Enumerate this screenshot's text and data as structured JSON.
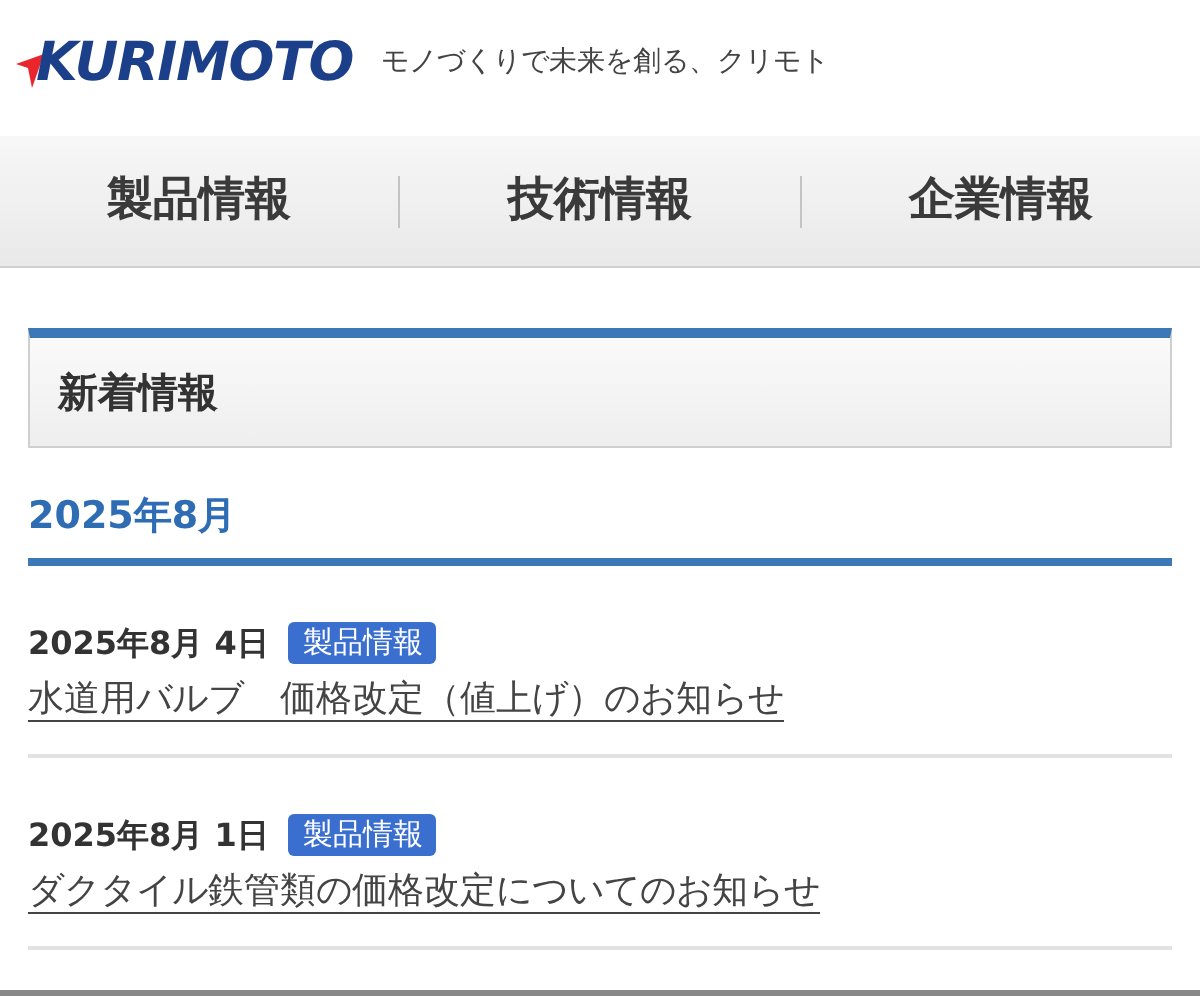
{
  "header": {
    "logo": "KURIMOTO",
    "tagline": "モノづくりで未来を創る、クリモト"
  },
  "nav": {
    "items": [
      {
        "label": "製品情報"
      },
      {
        "label": "技術情報"
      },
      {
        "label": "企業情報"
      }
    ]
  },
  "section": {
    "title": "新着情報"
  },
  "month": "2025年8月",
  "news": [
    {
      "date": "2025年8月 4日",
      "tag": "製品情報",
      "title": "水道用バルブ　価格改定（値上げ）のお知らせ"
    },
    {
      "date": "2025年8月 1日",
      "tag": "製品情報",
      "title": "ダクタイル鉄管類の価格改定についてのお知らせ"
    }
  ]
}
